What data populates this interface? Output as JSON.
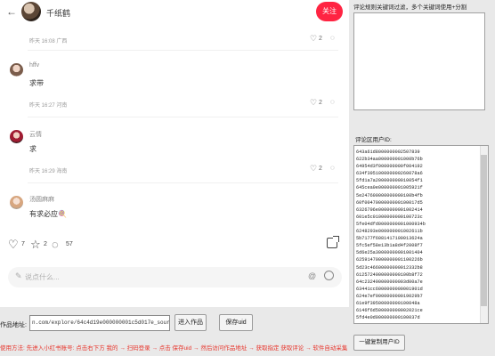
{
  "post": {
    "author_name": "千纸鹤",
    "follow_label": "关注",
    "meta": "昨天 16:08 广西",
    "likes": "2"
  },
  "comments": [
    {
      "name": "hffv",
      "text": "求带",
      "meta": "昨天 16:27 河南",
      "likes": "2"
    },
    {
      "name": "云情",
      "text": "求",
      "meta": "昨天 16:29 海南",
      "likes": "2"
    },
    {
      "name": "汤圆麻麻",
      "text": "有求必应",
      "emoji": "🍭",
      "meta": "",
      "likes": ""
    }
  ],
  "actions": {
    "likes": "7",
    "stars": "2",
    "comments": "57"
  },
  "comment_box": {
    "placeholder": "说点什么..."
  },
  "controls": {
    "url_label": "作品地址:",
    "url_value": "n.com/explore/64c4d19e000000001c5d017e_source=bailuoom",
    "enter_label": "进入作品",
    "save_label": "保存uid",
    "copy_label": "一键复制用户ID",
    "usage_text": "使用方法: 先进入小红书账号: 点击右下方 我的 → 扫码登录 → 点击 保存uid → 然后访问作品地址 → 获取指定 获取评论 → 软件自动采集"
  },
  "right_panel": {
    "keyword_label": "评论规则关键词过滤，多个关键词使用+分割",
    "uid_label": "评论区用户ID:",
    "uids": [
      "643a61d8000000002507839",
      "622b34aa000000001000b76b",
      "64954d3f000000000f004192",
      "634f395100000000260078a6",
      "5fd1a7a200000000010054f1",
      "645cea0e000000001005921f",
      "5e247600000000000100b4fb",
      "60f0047000000000100017d5",
      "6326796e0000000001002414",
      "601e5c01000000000100723c",
      "5fe04dfd0000000001000934b",
      "6248293e000000001002611b",
      "5b7177f6081417100013624a",
      "5fc5ef58e13b1a8d4f2008f7",
      "5d6e25a30000000001001404",
      "62591470000000001100226b",
      "5d23c46600000000012332b8",
      "6125724000000000100b8f72",
      "64c232490000000003d00a7e",
      "63441cc6000000000001901d",
      "624e7ef900000000019029b7",
      "61e9f39500000000100048a",
      "6146f6d500000000002021ce",
      "5fd4e0d000000000100037d"
    ]
  },
  "colors": {
    "accent": "#ff2442",
    "usage_text": "#e8362d"
  }
}
